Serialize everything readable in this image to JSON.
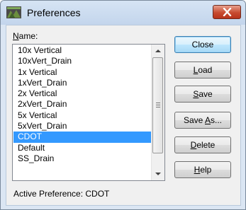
{
  "window": {
    "title": "Preferences"
  },
  "name_label": {
    "accel": "N",
    "rest": "ame:"
  },
  "list": {
    "items": [
      "10x Vertical",
      "10xVert_Drain",
      "1x Vertical",
      "1xVert_Drain",
      "2x Vertical",
      "2xVert_Drain",
      "5x Vertical",
      "5xVert_Drain",
      "CDOT",
      "Default",
      "SS_Drain"
    ],
    "selected_index": 8
  },
  "buttons": {
    "close": "Close",
    "load": {
      "accel": "L",
      "rest": "oad"
    },
    "save": {
      "accel": "S",
      "rest": "ave"
    },
    "save_as": {
      "pre": "Save ",
      "accel": "A",
      "rest": "s..."
    },
    "delete": {
      "accel": "D",
      "rest": "elete"
    },
    "help": {
      "accel": "H",
      "rest": "elp"
    }
  },
  "status": {
    "label": "Active Preference: ",
    "value": "CDOT"
  },
  "colors": {
    "selection": "#3399ff",
    "close_x": "#c74b30"
  },
  "icons": {
    "app": "preferences-app-icon",
    "close": "close-icon"
  }
}
